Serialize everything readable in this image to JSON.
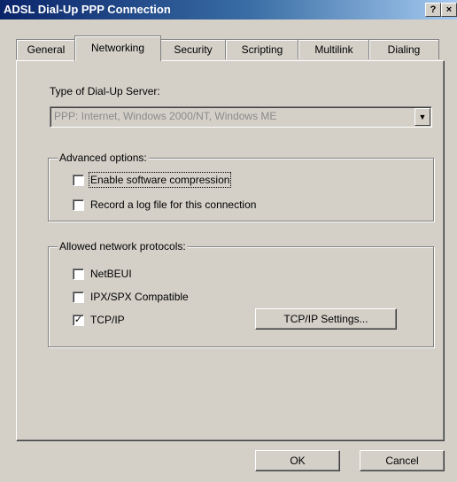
{
  "window": {
    "title": "ADSL Dial-Up PPP Connection",
    "help_label": "?",
    "close_label": "×"
  },
  "tabs": [
    {
      "label": "General"
    },
    {
      "label": "Networking"
    },
    {
      "label": "Security"
    },
    {
      "label": "Scripting"
    },
    {
      "label": "Multilink"
    },
    {
      "label": "Dialing"
    }
  ],
  "active_tab": "Networking",
  "server": {
    "label": "Type of Dial-Up Server:",
    "value": "PPP: Internet, Windows 2000/NT, Windows ME"
  },
  "advanced": {
    "title": "Advanced options:",
    "options": [
      {
        "label": "Enable software compression",
        "checked": false
      },
      {
        "label": "Record a log file for this connection",
        "checked": false
      }
    ]
  },
  "protocols": {
    "title": "Allowed network protocols:",
    "items": [
      {
        "label": "NetBEUI",
        "checked": false
      },
      {
        "label": "IPX/SPX Compatible",
        "checked": false
      },
      {
        "label": "TCP/IP",
        "checked": true
      }
    ],
    "settings_button": "TCP/IP Settings..."
  },
  "buttons": {
    "ok": "OK",
    "cancel": "Cancel"
  }
}
